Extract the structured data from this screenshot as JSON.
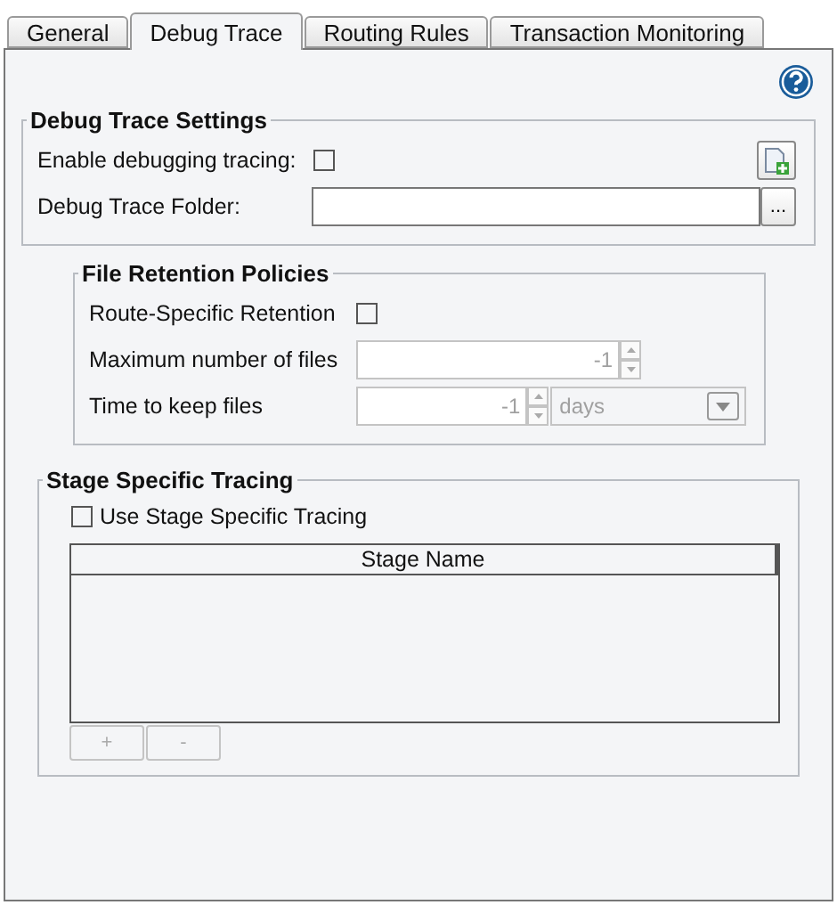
{
  "tabs": [
    {
      "label": "General",
      "selected": false
    },
    {
      "label": "Debug Trace",
      "selected": true
    },
    {
      "label": "Routing Rules",
      "selected": false
    },
    {
      "label": "Transaction Monitoring",
      "selected": false
    }
  ],
  "debug_trace_settings": {
    "title": "Debug Trace Settings",
    "enable_label": "Enable debugging tracing:",
    "enable_checked": false,
    "folder_label": "Debug Trace Folder:",
    "browse_button": "..."
  },
  "file_retention_policies": {
    "title": "File Retention Policies",
    "route_specific_label": "Route-Specific Retention",
    "route_specific_checked": false,
    "max_files": {
      "label": "Maximum number of files",
      "value": "-1",
      "disabled": true
    },
    "time_to_keep": {
      "label": "Time to keep files",
      "value": "-1",
      "unit": "days",
      "disabled": true
    }
  },
  "stage_specific_tracing": {
    "title": "Stage Specific Tracing",
    "use_label": "Use Stage Specific Tracing",
    "use_checked": false,
    "table": {
      "columns": [
        "Stage Name"
      ]
    },
    "buttons": [
      {
        "label": "+",
        "disabled": true
      },
      {
        "label": "-",
        "disabled": true
      }
    ]
  }
}
